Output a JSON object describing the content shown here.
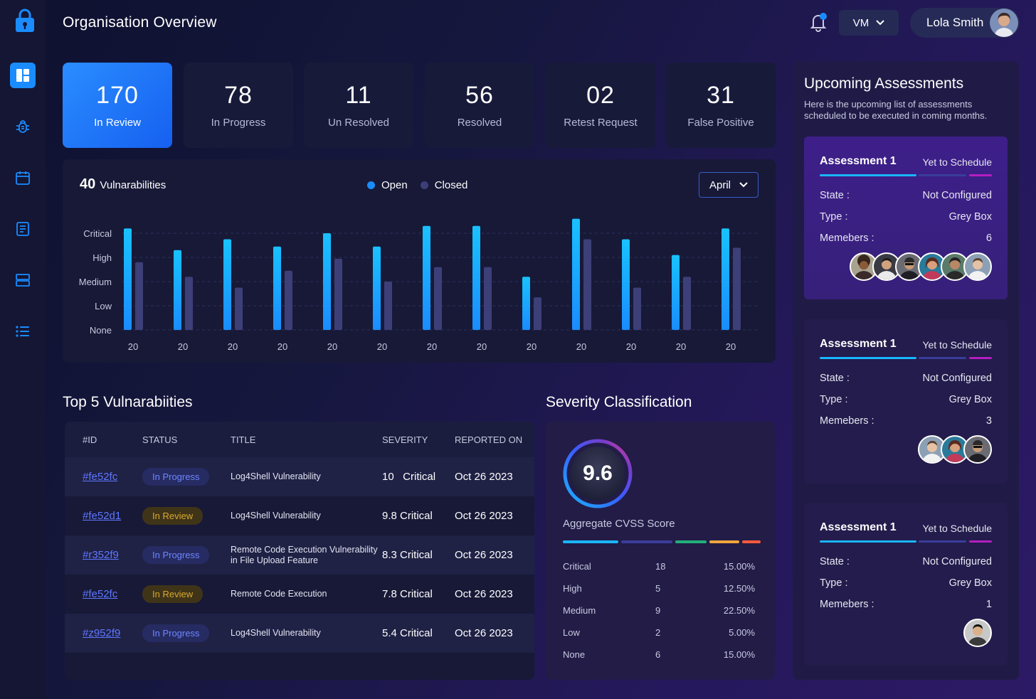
{
  "colors": {
    "accent": "#1a8cff",
    "open": "#19b6ff",
    "closed": "#3d3f78",
    "in_progress": "#6e86ff",
    "in_review": "#d8a92e"
  },
  "sidebar": {
    "items": [
      {
        "icon": "dashboard-icon",
        "active": true
      },
      {
        "icon": "bug-icon",
        "active": false
      },
      {
        "icon": "calendar-icon",
        "active": false
      },
      {
        "icon": "report-icon",
        "active": false
      },
      {
        "icon": "server-icon",
        "active": false
      },
      {
        "icon": "list-icon",
        "active": false
      }
    ]
  },
  "header": {
    "title": "Organisation Overview",
    "org_select": "VM",
    "user_name": "Lola Smith"
  },
  "stats": [
    {
      "value": "170",
      "label": "In Review"
    },
    {
      "value": "78",
      "label": "In Progress"
    },
    {
      "value": "11",
      "label": "Un Resolved"
    },
    {
      "value": "56",
      "label": "Resolved"
    },
    {
      "value": "02",
      "label": "Retest Request"
    },
    {
      "value": "31",
      "label": "False Positive"
    }
  ],
  "vuln_chart": {
    "count": "40",
    "count_label": "Vulnarabilities",
    "legend_open": "Open",
    "legend_closed": "Closed",
    "month": "April"
  },
  "chart_data": {
    "type": "bar",
    "categories": [
      "20",
      "20",
      "20",
      "20",
      "20",
      "20",
      "20",
      "20",
      "20",
      "20",
      "20",
      "20",
      "20"
    ],
    "y_categories": [
      "None",
      "Low",
      "Medium",
      "High",
      "Critical"
    ],
    "ylim": [
      0,
      4
    ],
    "series": [
      {
        "name": "Open",
        "values": [
          4.2,
          3.3,
          3.75,
          3.45,
          4.0,
          3.45,
          4.3,
          4.3,
          2.2,
          4.6,
          3.75,
          3.1,
          4.2
        ]
      },
      {
        "name": "Closed",
        "values": [
          2.8,
          2.2,
          1.75,
          2.45,
          2.95,
          2.0,
          2.6,
          2.6,
          1.35,
          3.75,
          1.75,
          2.2,
          3.4
        ]
      }
    ]
  },
  "top5": {
    "title": "Top 5 Vulnarabiities",
    "headers": {
      "id": "#ID",
      "status": "STATUS",
      "title": "TITLE",
      "severity": "SEVERITY",
      "reported": "REPORTED ON"
    },
    "rows": [
      {
        "id": "#fe52fc",
        "status": "In Progress",
        "status_type": "prog",
        "title": "Log4Shell Vulnerability",
        "severity": "10   Critical",
        "date": "Oct 26 2023"
      },
      {
        "id": "#fe52d1",
        "status": "In Review",
        "status_type": "rev",
        "title": "Log4Shell Vulnerability",
        "severity": "9.8 Critical",
        "date": "Oct 26 2023"
      },
      {
        "id": "#r352f9",
        "status": "In Progress",
        "status_type": "prog",
        "title": "Remote Code Execution Vulnerability in File Upload Feature",
        "severity": "8.3 Critical",
        "date": "Oct 26 2023"
      },
      {
        "id": "#fe52fc",
        "status": "In Review",
        "status_type": "rev",
        "title": "Remote Code Execution",
        "severity": "7.8 Critical",
        "date": "Oct 26 2023"
      },
      {
        "id": "#z952f9",
        "status": "In Progress",
        "status_type": "prog",
        "title": "Log4Shell Vulnerability",
        "severity": "5.4 Critical",
        "date": "Oct 26 2023"
      }
    ]
  },
  "severity": {
    "title": "Severity Classification",
    "score": "9.6",
    "score_label": "Aggregate CVSS Score",
    "rows": [
      {
        "name": "Critical",
        "count": "18",
        "pct": "15.00%"
      },
      {
        "name": "High",
        "count": "5",
        "pct": "12.50%"
      },
      {
        "name": "Medium",
        "count": "9",
        "pct": "22.50%"
      },
      {
        "name": "Low",
        "count": "2",
        "pct": "5.00%"
      },
      {
        "name": "None",
        "count": "6",
        "pct": "15.00%"
      }
    ]
  },
  "upcoming": {
    "title": "Upcoming Assessments",
    "subtitle": "Here is the upcoming list of assessments scheduled to be executed in coming months.",
    "state_label": "State :",
    "type_label": "Type :",
    "members_label": "Memebers :",
    "cards": [
      {
        "name": "Assessment 1",
        "status": "Yet to Schedule",
        "state": "Not Configured",
        "type": "Grey Box",
        "members": "6"
      },
      {
        "name": "Assessment 1",
        "status": "Yet to Schedule",
        "state": "Not Configured",
        "type": "Grey Box",
        "members": "3"
      },
      {
        "name": "Assessment 1",
        "status": "Yet to Schedule",
        "state": "Not Configured",
        "type": "Grey Box",
        "members": "1"
      }
    ]
  }
}
